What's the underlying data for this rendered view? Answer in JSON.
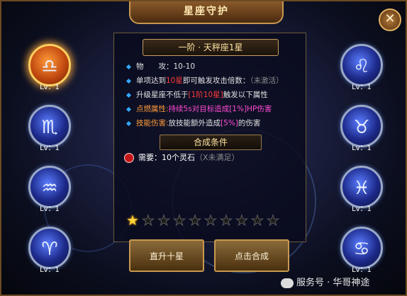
{
  "window": {
    "title": "星座守护",
    "close_glyph": "✕"
  },
  "detail": {
    "title": "一阶 · 天秤座1星",
    "rows": [
      {
        "segments": [
          {
            "text": "物　　攻：",
            "color": "#e0e0e0"
          },
          {
            "text": "10-10",
            "color": "#e0e0e0"
          }
        ]
      },
      {
        "segments": [
          {
            "text": "单项达到",
            "color": "#e0e0e0"
          },
          {
            "text": "10星",
            "color": "#ff3a3a"
          },
          {
            "text": "即可触发攻击倍数：",
            "color": "#e0e0e0"
          },
          {
            "text": "（未激活）",
            "color": "#8a8a8a"
          }
        ]
      },
      {
        "segments": [
          {
            "text": "升级星座不低于",
            "color": "#e0e0e0"
          },
          {
            "text": "[1阶10星]",
            "color": "#ff3a3a"
          },
          {
            "text": "触发以下属性",
            "color": "#e0e0e0"
          }
        ]
      },
      {
        "segments": [
          {
            "text": "点燃属性:",
            "color": "#ff9a3a"
          },
          {
            "text": "持续5s对目标造成[1%]HP伤害",
            "color": "#ff4ad2"
          }
        ]
      },
      {
        "segments": [
          {
            "text": "技能伤害:",
            "color": "#ff9a3a"
          },
          {
            "text": "放技能额外造成",
            "color": "#e0e0e0"
          },
          {
            "text": "[5%]",
            "color": "#ff4ad2"
          },
          {
            "text": "的伤害",
            "color": "#e0e0e0"
          }
        ]
      }
    ]
  },
  "synthesis": {
    "title": "合成条件",
    "requirement": {
      "label": "需要：",
      "value": "10个灵石",
      "status": "（X未满足）",
      "label_color": "#ffffff",
      "status_color": "#8a8a8a"
    }
  },
  "stars": {
    "total": 10,
    "filled": 1
  },
  "buttons": {
    "upgrade": "直升十星",
    "synthesize": "点击合成"
  },
  "signs_left": [
    {
      "name": "libra",
      "glyph": "♎",
      "level": "Lv：1",
      "active": true
    },
    {
      "name": "scorpio",
      "glyph": "♏",
      "level": "Lv：1",
      "active": false
    },
    {
      "name": "aquarius",
      "glyph": "♒",
      "level": "Lv：1",
      "active": false
    },
    {
      "name": "aries",
      "glyph": "♈",
      "level": "Lv：1",
      "active": false
    }
  ],
  "signs_right": [
    {
      "name": "leo",
      "glyph": "♌",
      "level": "Lv：1",
      "active": false
    },
    {
      "name": "taurus",
      "glyph": "♉",
      "level": "Lv：1",
      "active": false
    },
    {
      "name": "pisces",
      "glyph": "♓",
      "level": "Lv：1",
      "active": false
    },
    {
      "name": "cancer",
      "glyph": "♋",
      "level": "Lv：1",
      "active": false
    }
  ],
  "watermark": {
    "text": "服务号 · 华哥神途",
    "icon": "wechat-icon"
  }
}
